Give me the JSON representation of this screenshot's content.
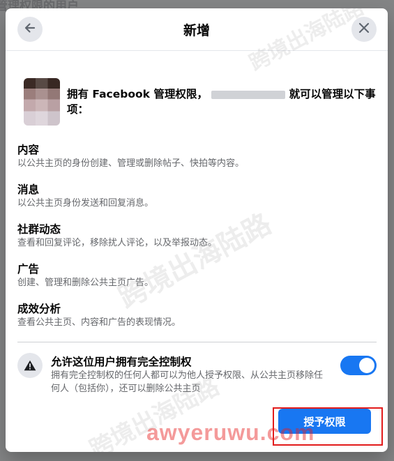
{
  "background": {
    "title": "管理权限的用户"
  },
  "dialog": {
    "title": "新增",
    "back_icon": "arrow-left-icon",
    "close_icon": "close-icon"
  },
  "intro": {
    "text_before": "拥有 Facebook 管理权限，",
    "text_after": "就可以管理以下事项："
  },
  "permissions": [
    {
      "title": "内容",
      "desc": "以公共主页的身份创建、管理或删除帖子、快拍等内容。"
    },
    {
      "title": "消息",
      "desc": "以公共主页身份发送和回复消息。"
    },
    {
      "title": "社群动态",
      "desc": "查看和回复评论，移除扰人评论，以及举报动态。"
    },
    {
      "title": "广告",
      "desc": "创建、管理和删除公共主页广告。"
    },
    {
      "title": "成效分析",
      "desc": "查看公共主页、内容和广告的表现情况。"
    }
  ],
  "full_control": {
    "title": "允许这位用户拥有完全控制权",
    "desc": "拥有完全控制权的任何人都可以为他人授予权限、从公共主页移除任何人（包括你），还可以删除公共主页",
    "enabled": true,
    "icon": "warning-icon"
  },
  "grant_button": {
    "label": "授予权限"
  },
  "watermark": {
    "text": "跨境出海陆路",
    "site": "awyeruwu.com"
  },
  "colors": {
    "accent": "#1877f2",
    "highlight": "#e21b1b"
  }
}
